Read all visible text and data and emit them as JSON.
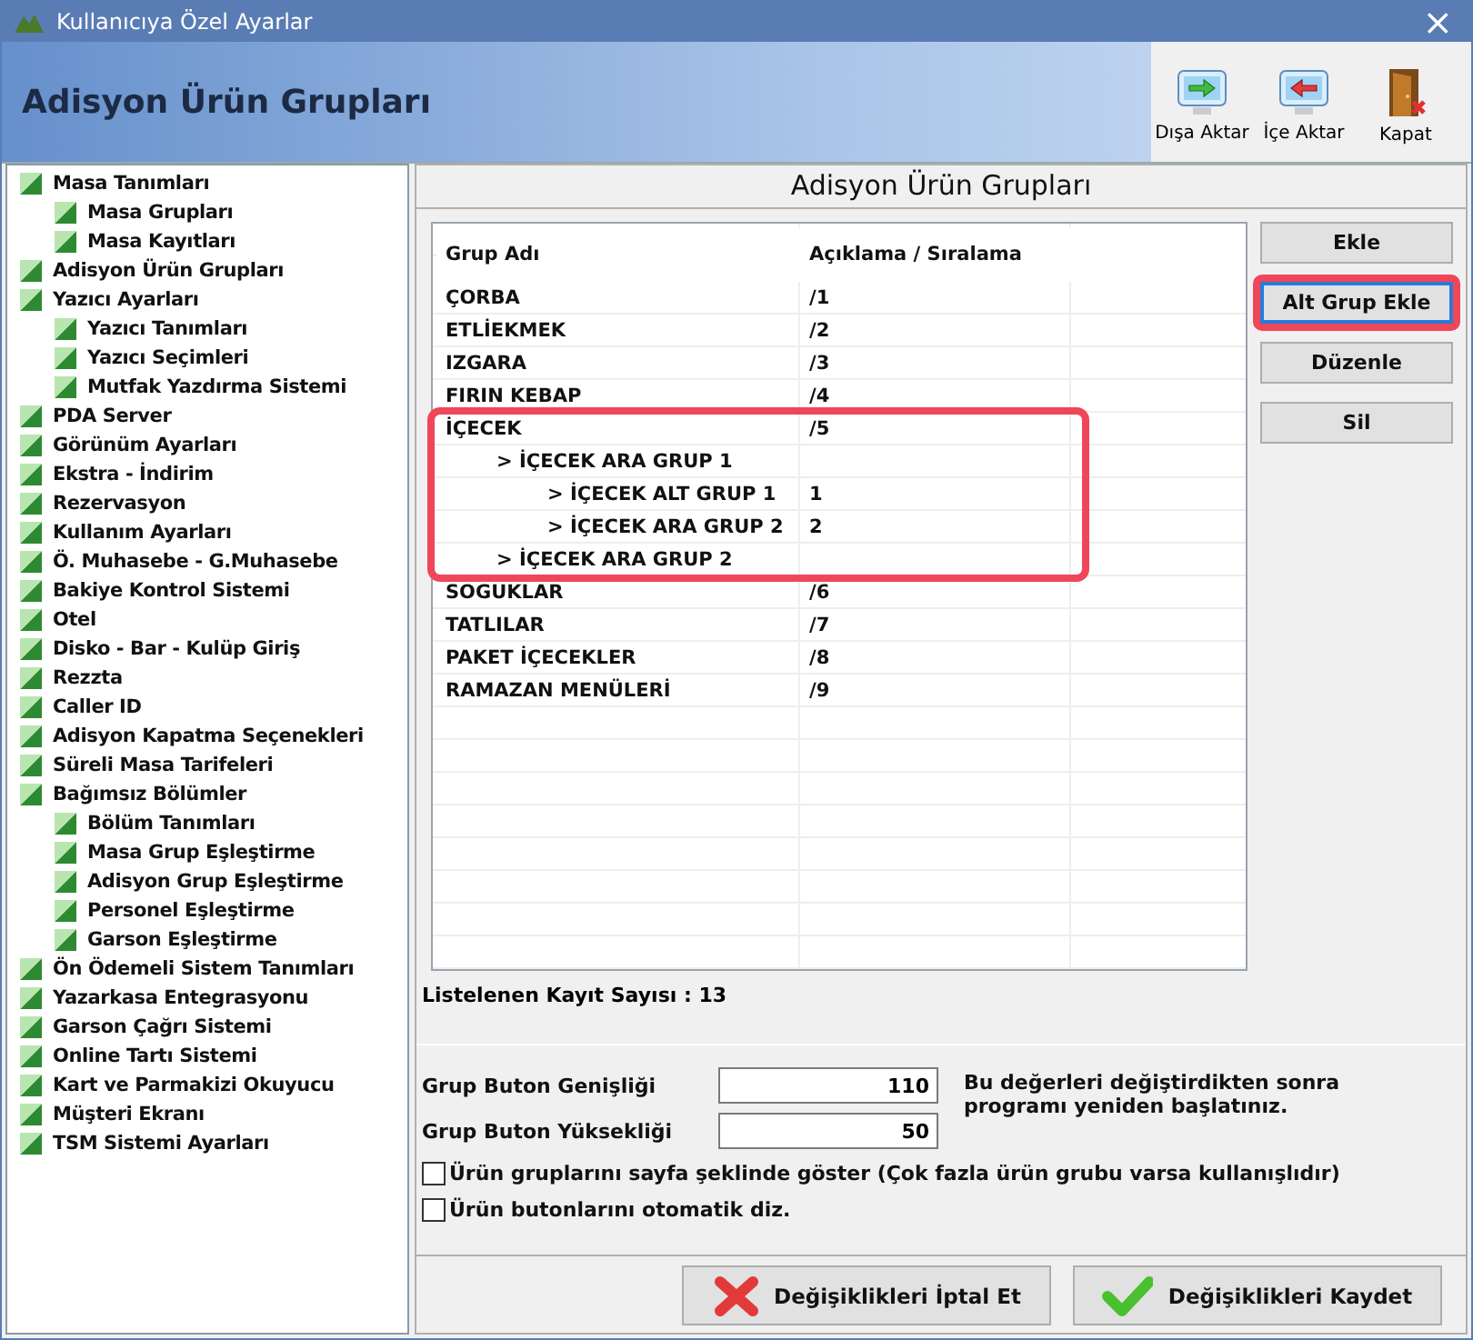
{
  "window": {
    "title": "Kullanıcıya Özel Ayarlar",
    "close": "×"
  },
  "header": {
    "title": "Adisyon Ürün Grupları",
    "tools": [
      {
        "label": "Dışa Aktar",
        "kind": "export"
      },
      {
        "label": "İçe Aktar",
        "kind": "import"
      },
      {
        "label": "Kapat",
        "kind": "close"
      }
    ]
  },
  "sidebar": {
    "items": [
      {
        "label": "Masa Tanımları",
        "children": [
          {
            "label": "Masa Grupları"
          },
          {
            "label": "Masa Kayıtları"
          }
        ]
      },
      {
        "label": "Adisyon Ürün Grupları"
      },
      {
        "label": "Yazıcı Ayarları",
        "children": [
          {
            "label": "Yazıcı Tanımları"
          },
          {
            "label": "Yazıcı Seçimleri"
          },
          {
            "label": "Mutfak Yazdırma Sistemi"
          }
        ]
      },
      {
        "label": "PDA Server"
      },
      {
        "label": "Görünüm Ayarları"
      },
      {
        "label": "Ekstra - İndirim"
      },
      {
        "label": "Rezervasyon"
      },
      {
        "label": "Kullanım Ayarları"
      },
      {
        "label": "Ö. Muhasebe - G.Muhasebe"
      },
      {
        "label": "Bakiye Kontrol Sistemi"
      },
      {
        "label": "Otel"
      },
      {
        "label": "Disko - Bar - Kulüp Giriş"
      },
      {
        "label": "Rezzta"
      },
      {
        "label": "Caller ID"
      },
      {
        "label": "Adisyon Kapatma Seçenekleri"
      },
      {
        "label": "Süreli Masa Tarifeleri"
      },
      {
        "label": "Bağımsız Bölümler",
        "children": [
          {
            "label": "Bölüm Tanımları"
          },
          {
            "label": "Masa Grup Eşleştirme"
          },
          {
            "label": "Adisyon Grup Eşleştirme"
          },
          {
            "label": "Personel Eşleştirme"
          },
          {
            "label": "Garson Eşleştirme"
          }
        ]
      },
      {
        "label": "Ön Ödemeli Sistem Tanımları"
      },
      {
        "label": "Yazarkasa Entegrasyonu"
      },
      {
        "label": "Garson Çağrı Sistemi"
      },
      {
        "label": "Online Tartı Sistemi"
      },
      {
        "label": "Kart ve Parmakizi Okuyucu"
      },
      {
        "label": "Müşteri Ekranı"
      },
      {
        "label": "TSM Sistemi Ayarları"
      }
    ]
  },
  "panel": {
    "title": "Adisyon Ürün Grupları",
    "table": {
      "columns": [
        "Grup Adı",
        "Açıklama / Sıralama"
      ],
      "rows": [
        {
          "name": "ÇORBA",
          "note": "/1",
          "highlighted": false
        },
        {
          "name": "ETLİEKMEK",
          "note": "/2",
          "highlighted": false
        },
        {
          "name": "IZGARA",
          "note": "/3",
          "highlighted": false
        },
        {
          "name": "FIRIN KEBAP",
          "note": "/4",
          "highlighted": false
        },
        {
          "name": "İÇECEK",
          "note": "/5",
          "highlighted": true,
          "children": [
            {
              "name": "> İÇECEK ARA GRUP 1",
              "children": [
                {
                  "name": "> İÇECEK ALT GRUP 1",
                  "note": "1"
                },
                {
                  "name": "> İÇECEK ARA GRUP 2",
                  "note": "2"
                }
              ]
            },
            {
              "name": "> İÇECEK ARA GRUP 2"
            }
          ]
        },
        {
          "name": "SOGUKLAR",
          "note": "/6",
          "highlighted": false
        },
        {
          "name": "TATLILAR",
          "note": "/7",
          "highlighted": false
        },
        {
          "name": "PAKET İÇECEKLER",
          "note": "/8",
          "highlighted": false
        },
        {
          "name": "RAMAZAN MENÜLERİ",
          "note": "/9",
          "highlighted": false
        }
      ]
    },
    "buttons": [
      {
        "label": "Ekle",
        "focused": false,
        "highlighted": false
      },
      {
        "label": "Alt Grup Ekle",
        "focused": true,
        "highlighted": true
      },
      {
        "label": "Düzenle",
        "focused": false,
        "highlighted": false
      },
      {
        "label": "Sil",
        "focused": false,
        "highlighted": false
      }
    ],
    "record_count": "Listelenen Kayıt Sayısı : 13",
    "fields": [
      {
        "label": "Grup Buton Genişliği",
        "value": "110"
      },
      {
        "label": "Grup Buton Yüksekliği",
        "value": "50"
      }
    ],
    "hint": "Bu değerleri değiştirdikten sonra programı yeniden başlatınız.",
    "options": [
      {
        "label": "Ürün gruplarını sayfa şeklinde göster (Çok fazla ürün grubu varsa kullanışlıdır)",
        "checked": false
      },
      {
        "label": "Ürün butonlarını otomatik diz.",
        "checked": false
      }
    ],
    "actions": [
      {
        "label": "Değişiklikleri İptal Et",
        "kind": "cancel"
      },
      {
        "label": "Değişiklikleri Kaydet",
        "kind": "save"
      }
    ]
  }
}
